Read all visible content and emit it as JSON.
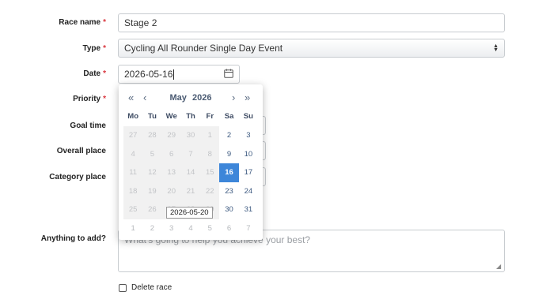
{
  "form": {
    "race_name": {
      "label": "Race name",
      "required": "*",
      "value": "Stage 2"
    },
    "type": {
      "label": "Type",
      "required": "*",
      "value": "Cycling All Rounder Single Day Event"
    },
    "date": {
      "label": "Date",
      "required": "*",
      "value": "2026-05-16"
    },
    "priority": {
      "label": "Priority",
      "required": "*"
    },
    "goal_time": {
      "label": "Goal time"
    },
    "overall_place": {
      "label": "Overall place"
    },
    "category_place": {
      "label": "Category place"
    },
    "notes": {
      "label": "Anything to add?",
      "placeholder": "What's going to help you achieve your best?"
    },
    "delete": {
      "label": "Delete race"
    }
  },
  "datepicker": {
    "month": "May",
    "year": "2026",
    "nav": {
      "prev_year": "«",
      "prev_month": "‹",
      "next_month": "›",
      "next_year": "»"
    },
    "weekdays": [
      "Mo",
      "Tu",
      "We",
      "Th",
      "Fr",
      "Sa",
      "Su"
    ],
    "tooltip": "2026-05-20",
    "weeks": [
      [
        {
          "d": "27",
          "s": "other disabled"
        },
        {
          "d": "28",
          "s": "other disabled"
        },
        {
          "d": "29",
          "s": "other disabled"
        },
        {
          "d": "30",
          "s": "other disabled"
        },
        {
          "d": "1",
          "s": "disabled"
        },
        {
          "d": "2",
          "s": ""
        },
        {
          "d": "3",
          "s": ""
        }
      ],
      [
        {
          "d": "4",
          "s": "disabled"
        },
        {
          "d": "5",
          "s": "disabled"
        },
        {
          "d": "6",
          "s": "disabled"
        },
        {
          "d": "7",
          "s": "disabled"
        },
        {
          "d": "8",
          "s": "disabled"
        },
        {
          "d": "9",
          "s": ""
        },
        {
          "d": "10",
          "s": ""
        }
      ],
      [
        {
          "d": "11",
          "s": "disabled"
        },
        {
          "d": "12",
          "s": "disabled"
        },
        {
          "d": "13",
          "s": "disabled"
        },
        {
          "d": "14",
          "s": "disabled"
        },
        {
          "d": "15",
          "s": "disabled"
        },
        {
          "d": "16",
          "s": "selected"
        },
        {
          "d": "17",
          "s": ""
        }
      ],
      [
        {
          "d": "18",
          "s": "disabled"
        },
        {
          "d": "19",
          "s": "disabled"
        },
        {
          "d": "20",
          "s": "disabled"
        },
        {
          "d": "21",
          "s": "disabled"
        },
        {
          "d": "22",
          "s": "disabled"
        },
        {
          "d": "23",
          "s": ""
        },
        {
          "d": "24",
          "s": ""
        }
      ],
      [
        {
          "d": "25",
          "s": "disabled"
        },
        {
          "d": "26",
          "s": "disabled"
        },
        {
          "d": "27",
          "s": "disabled"
        },
        {
          "d": "28",
          "s": "disabled"
        },
        {
          "d": "29",
          "s": "disabled"
        },
        {
          "d": "30",
          "s": ""
        },
        {
          "d": "31",
          "s": ""
        }
      ],
      [
        {
          "d": "1",
          "s": "other"
        },
        {
          "d": "2",
          "s": "other"
        },
        {
          "d": "3",
          "s": "other"
        },
        {
          "d": "4",
          "s": "other"
        },
        {
          "d": "5",
          "s": "other"
        },
        {
          "d": "6",
          "s": "other"
        },
        {
          "d": "7",
          "s": "other"
        }
      ]
    ]
  },
  "icons": {
    "calendar": "calendar-icon",
    "select_arrows": "select-arrows-icon"
  },
  "colors": {
    "required": "#d9363e",
    "selected_day": "#3d86d9"
  }
}
